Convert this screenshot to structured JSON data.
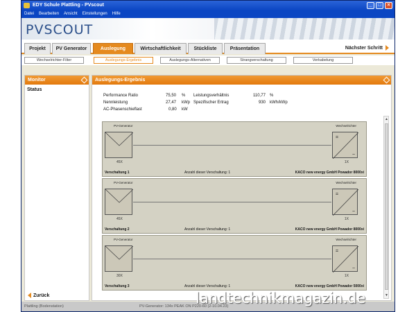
{
  "window": {
    "title": "EDY Schule Plattling - PVscout"
  },
  "menu": [
    "Datei",
    "Bearbeiten",
    "Ansicht",
    "Einstellungen",
    "Hilfe"
  ],
  "logo": "PVSCOUT",
  "tabs": [
    "Projekt",
    "PV Generator",
    "Auslegung",
    "Wirtschaftlichkeit",
    "Stückliste",
    "Präsentation"
  ],
  "next_step": "Nächster Schritt",
  "subtabs": [
    "Wechselrichter-Filter",
    "Auslegungs-Ergebnis",
    "Auslegungs-Alternativen",
    "Strangverschaltung",
    "Verkabelung"
  ],
  "monitor": {
    "title": "Monitor",
    "status": "Status",
    "back": "Zurück"
  },
  "result": {
    "title": "Auslegungs-Ergebnis",
    "metrics": {
      "perf_label": "Performance Ratio",
      "perf_value": "75,50",
      "perf_unit": "%",
      "nenn_label": "Nennleistung",
      "nenn_value": "27,47",
      "nenn_unit": "kWp",
      "ac_label": "AC-Phasenschieflast",
      "ac_value": "0,80",
      "ac_unit": "kW",
      "lv_label": "Leistungsverhältnis",
      "lv_value": "110,77",
      "lv_unit": "%",
      "se_label": "Spezifischer Ertrag",
      "se_value": "930",
      "se_unit": "kWh/kWp"
    },
    "circuits": [
      {
        "gen_label": "PV-Generator",
        "inv_label": "Wechselrichter",
        "modules": "45X",
        "inverters": "1X",
        "name": "Verschaltung 1",
        "count_label": "Anzahl dieser Verschaltung:",
        "count": "1",
        "inverter": "KACO new energy GmbH Powador 8000xi"
      },
      {
        "gen_label": "PV-Generator",
        "inv_label": "Wechselrichter",
        "modules": "45X",
        "inverters": "1X",
        "name": "Verschaltung 2",
        "count_label": "Anzahl dieser Verschaltung:",
        "count": "1",
        "inverter": "KACO new energy GmbH Powador 8000xi"
      },
      {
        "gen_label": "PV-Generator",
        "inv_label": "Wechselrichter",
        "modules": "30X",
        "inverters": "1X",
        "name": "Verschaltung 3",
        "count_label": "Anzahl dieser Verschaltung:",
        "count": "1",
        "inverter": "KACO new energy GmbH Powador 5000xi"
      }
    ]
  },
  "statusbar": {
    "left": "Plattling (Bodenstation)",
    "mid": "PV-Generator: 134x PEAK ON P220-60 (2-10.04.23)"
  },
  "watermark": "landtechnikmagazin.de",
  "colors": {
    "accent": "#e58a1f",
    "titlebar": "#0b46c3"
  }
}
